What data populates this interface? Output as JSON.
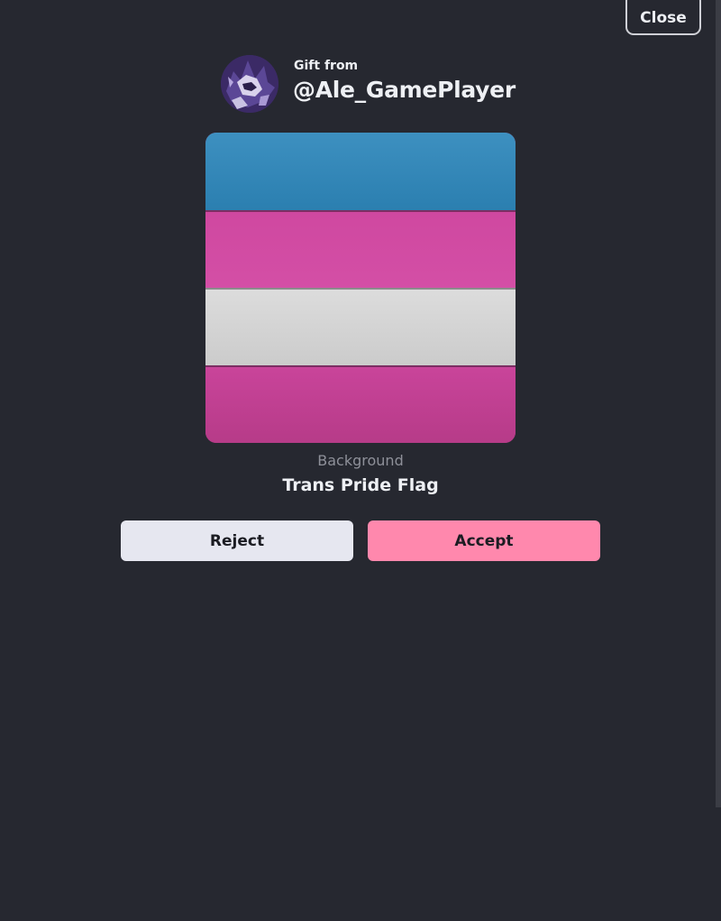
{
  "header": {
    "close_label": "Close"
  },
  "gift": {
    "from_label": "Gift from",
    "sender": "@Ale_GamePlayer"
  },
  "item": {
    "type": "Background",
    "name": "Trans Pride Flag",
    "stripe_colors": [
      "#2f86b8",
      "#d24a9f",
      "#d3d3d3",
      "#c0408e"
    ]
  },
  "actions": {
    "reject_label": "Reject",
    "accept_label": "Accept",
    "accept_color": "#ff88ad",
    "reject_color": "#e6e7f0"
  },
  "colors": {
    "background": "#262830"
  }
}
